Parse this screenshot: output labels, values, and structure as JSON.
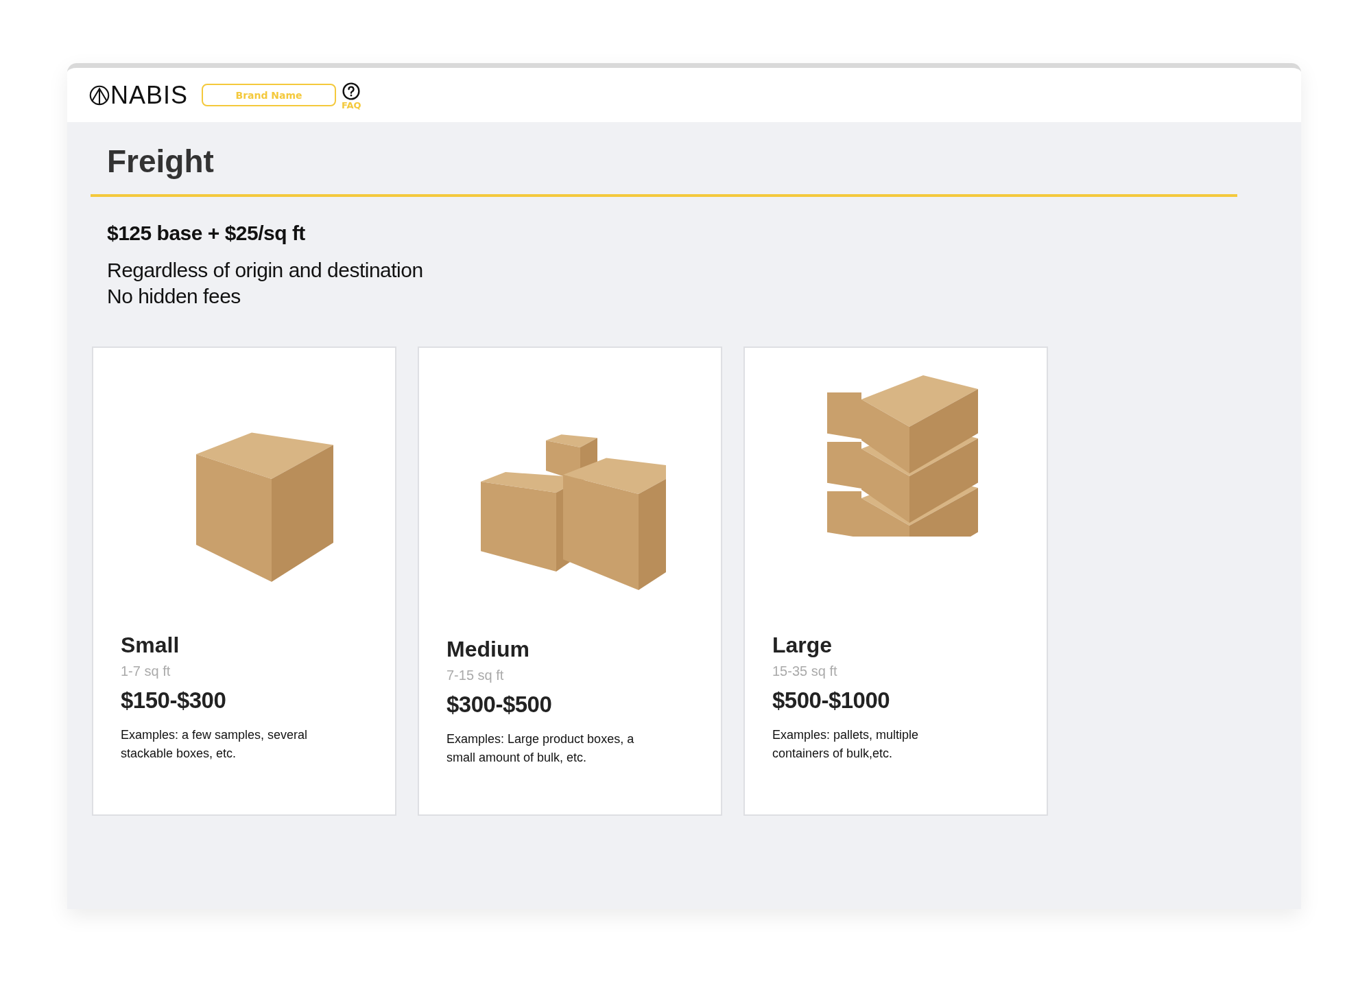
{
  "header": {
    "logo": "NABIS",
    "brand_field": {
      "placeholder": "Brand Name"
    },
    "faq": "FAQ"
  },
  "page": {
    "title": "Freight",
    "rate": "$125 base + $25/sq ft",
    "notes": [
      "Regardless of origin and destination",
      "No hidden fees"
    ]
  },
  "cards": [
    {
      "kind": "single",
      "name": "Small",
      "size": "1-7 sq ft",
      "price": "$150-$300",
      "examples": "Examples: a few samples, several stackable boxes, etc."
    },
    {
      "kind": "group",
      "name": "Medium",
      "size": "7-15 sq ft",
      "price": "$300-$500",
      "examples": "Examples: Large product boxes, a small amount of bulk, etc."
    },
    {
      "kind": "stack",
      "name": "Large",
      "size": "15-35 sq ft",
      "price": "$500-$1000",
      "examples": "Examples: pallets, multiple containers of bulk,etc."
    }
  ]
}
